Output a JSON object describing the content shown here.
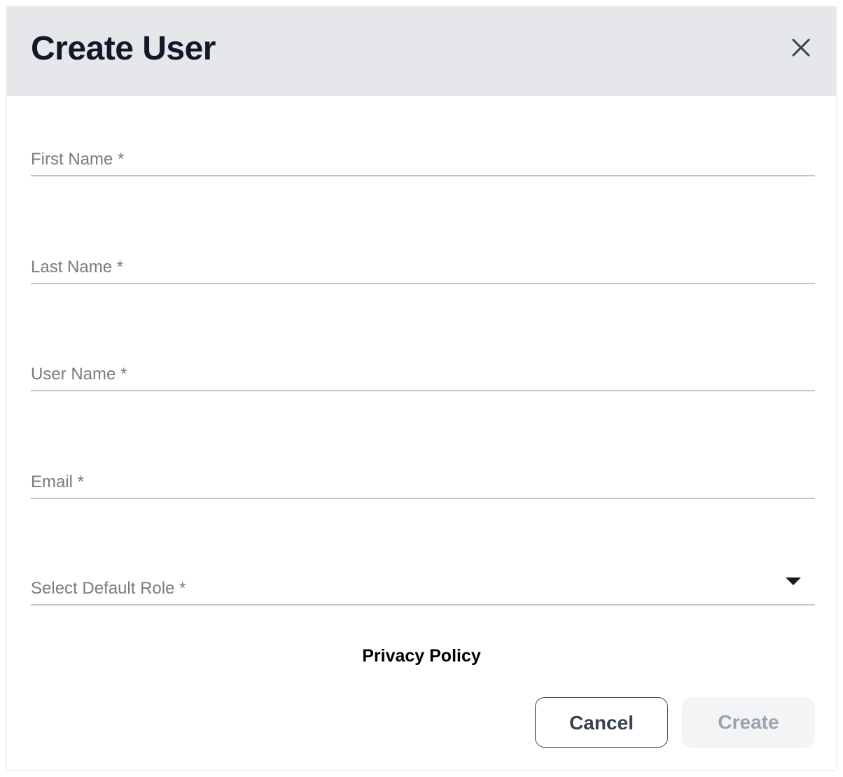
{
  "dialog": {
    "title": "Create User",
    "close_icon": "close-icon"
  },
  "form": {
    "fields": [
      {
        "label": "First Name *",
        "value": ""
      },
      {
        "label": "Last Name *",
        "value": ""
      },
      {
        "label": "User Name *",
        "value": ""
      },
      {
        "label": "Email *",
        "value": ""
      }
    ],
    "role_select": {
      "label": "Select Default Role *",
      "value": "",
      "icon": "dropdown-arrow-icon"
    }
  },
  "footer": {
    "privacy_link": "Privacy Policy",
    "cancel_label": "Cancel",
    "create_label": "Create",
    "create_disabled": true
  },
  "colors": {
    "header_bg": "#e5e7eb",
    "title": "#111827",
    "label": "#7b7b7b",
    "underline": "#c4c4c4",
    "create_disabled_bg": "#f3f4f6",
    "create_disabled_text": "#9ca3af"
  }
}
